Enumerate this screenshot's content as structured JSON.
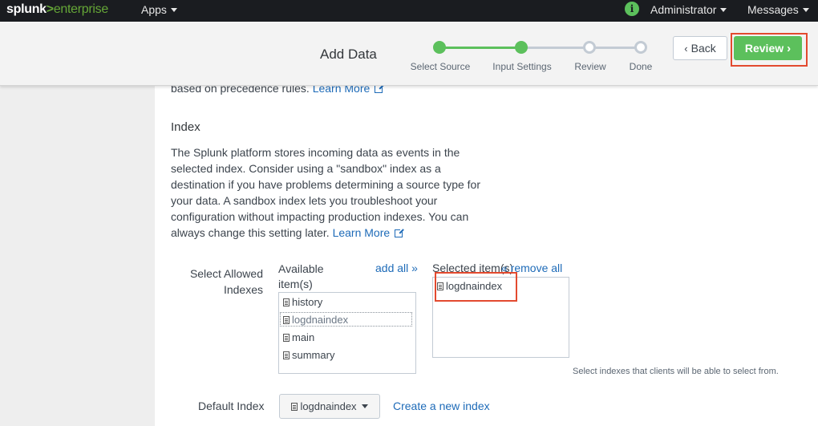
{
  "topbar": {
    "logo_splunk": "splunk",
    "logo_gt": ">",
    "logo_enterprise": "enterprise",
    "apps_label": "Apps",
    "user_label": "Administrator",
    "messages_label": "Messages",
    "info_glyph": "i"
  },
  "wizard": {
    "title": "Add Data",
    "steps": [
      {
        "label": "Select Source",
        "state": "done"
      },
      {
        "label": "Input Settings",
        "state": "done"
      },
      {
        "label": "Review",
        "state": "todo"
      },
      {
        "label": "Done",
        "state": "todo"
      }
    ],
    "back_label": "Back",
    "review_label": "Review",
    "accent_color": "#5cc05c"
  },
  "content": {
    "precedence_text": "based on precedence rules.",
    "learn_more": "Learn More",
    "index_title": "Index",
    "index_paragraph": "The Splunk platform stores incoming data as events in the selected index. Consider using a \"sandbox\" index as a destination if you have problems determining a source type for your data. A sandbox index lets you troubleshoot your configuration without impacting production indexes. You can always change this setting later.",
    "learn_more_2": "Learn More",
    "allowed_label_1": "Select Allowed",
    "allowed_label_2": "Indexes",
    "available_header_1": "Available",
    "available_header_2": "item(s)",
    "add_all": "add all »",
    "selected_header": "Selected item(s)",
    "remove_all": "« remove all",
    "available_items": [
      "history",
      "logdnaindex",
      "main",
      "summary"
    ],
    "selected_items": [
      "logdnaindex"
    ],
    "note": "Select indexes that clients will be able to select from.",
    "default_index_label": "Default Index",
    "default_index_value": "logdnaindex",
    "create_index_link": "Create a new index"
  }
}
